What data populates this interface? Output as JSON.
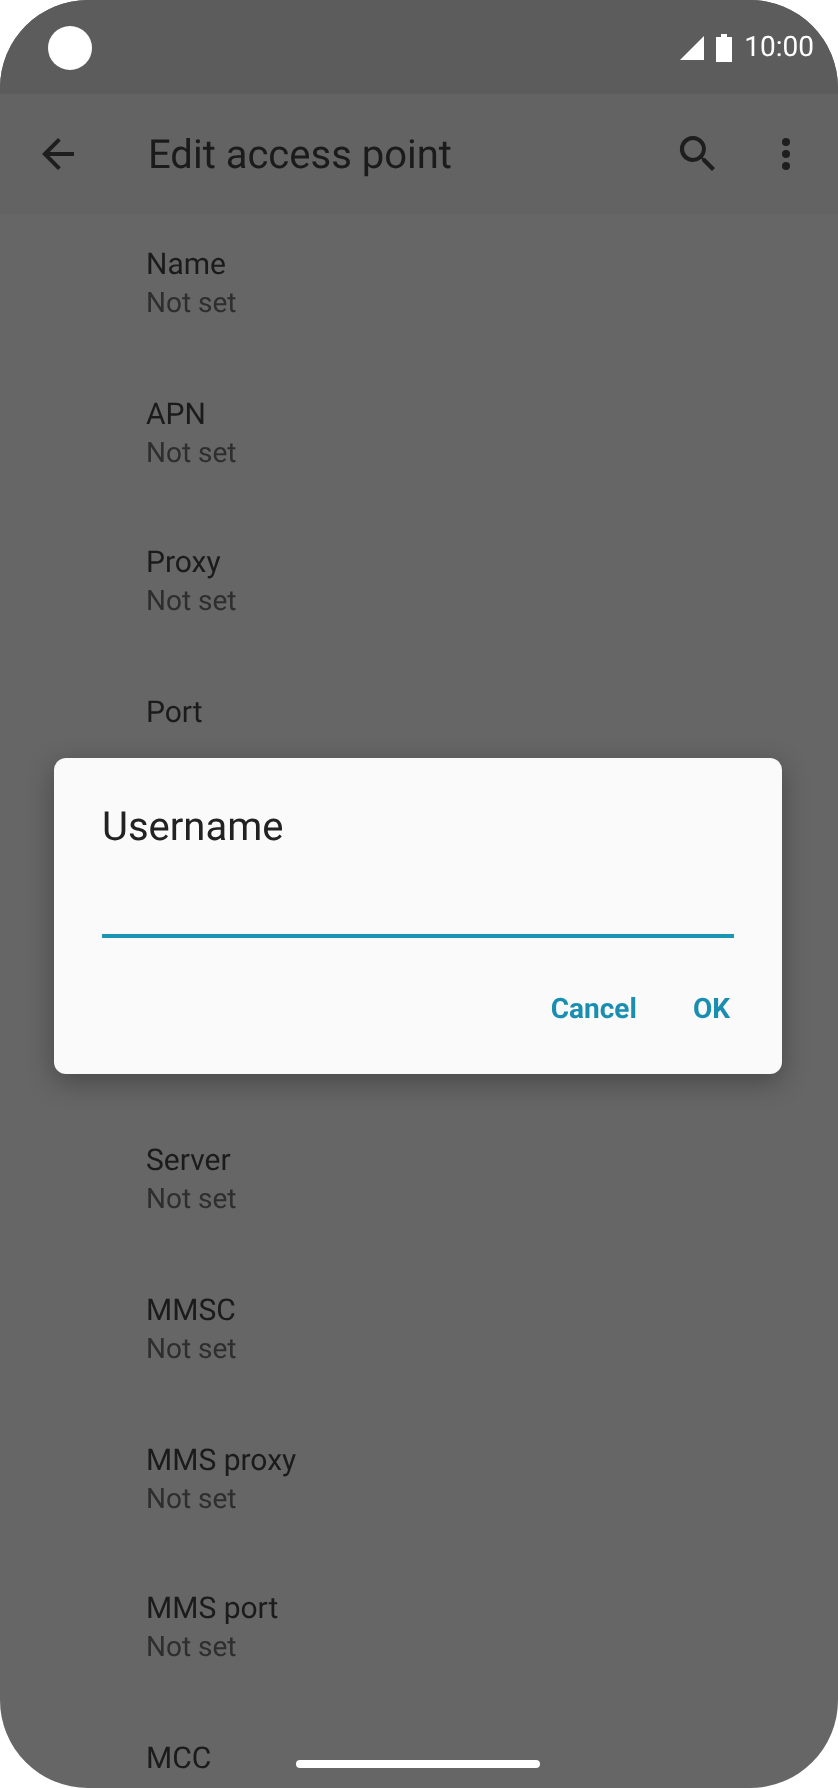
{
  "status_bar": {
    "time": "10:00"
  },
  "app_bar": {
    "title": "Edit access point"
  },
  "settings_above": [
    {
      "title": "Name",
      "summary": "Not set"
    },
    {
      "title": "APN",
      "summary": "Not set"
    },
    {
      "title": "Proxy",
      "summary": "Not set"
    },
    {
      "title": "Port"
    }
  ],
  "settings_below": [
    {
      "title": "Server",
      "summary": "Not set"
    },
    {
      "title": "MMSC",
      "summary": "Not set"
    },
    {
      "title": "MMS proxy",
      "summary": "Not set"
    },
    {
      "title": "MMS port",
      "summary": "Not set"
    },
    {
      "title": "MCC"
    }
  ],
  "dialog": {
    "title": "Username",
    "buttons": [
      "Cancel",
      "OK"
    ]
  }
}
